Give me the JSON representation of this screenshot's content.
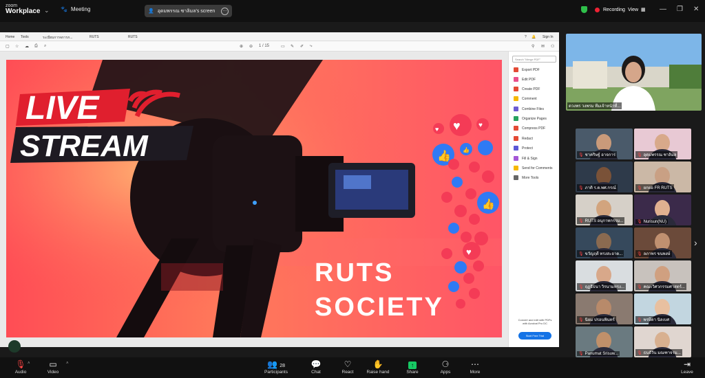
{
  "app": {
    "title_small": "zoom",
    "title": "Workplace"
  },
  "topbar": {
    "meeting_label": "Meeting",
    "share_label": "อุดมพรรณ ซาลิมล's screen",
    "recording_label": "Recording",
    "view_label": "View"
  },
  "acrobat": {
    "tabs": [
      "Home",
      "Tools",
      "ระเบียบการจการก...",
      "RUTS",
      "RUTS"
    ],
    "right_links": [
      "Sign In"
    ],
    "page_indicator": "1  /  15",
    "search_placeholder": "Search \"Merge PDF\"",
    "tools": [
      {
        "label": "Export PDF",
        "color": "#e34a35"
      },
      {
        "label": "Edit PDF",
        "color": "#e94f8b"
      },
      {
        "label": "Create PDF",
        "color": "#e34a35"
      },
      {
        "label": "Comment",
        "color": "#f5b800"
      },
      {
        "label": "Combine Files",
        "color": "#6b5bd2"
      },
      {
        "label": "Organize Pages",
        "color": "#27a25f"
      },
      {
        "label": "Compress PDF",
        "color": "#e34a35"
      },
      {
        "label": "Redact",
        "color": "#e34a35"
      },
      {
        "label": "Protect",
        "color": "#5b57d6"
      },
      {
        "label": "Fill & Sign",
        "color": "#a457d6"
      },
      {
        "label": "Send for Comments",
        "color": "#f5b800"
      },
      {
        "label": "More Tools",
        "color": "#666666"
      }
    ],
    "promo_text": "Convert and edit with PDFs with Acrobat Pro DC",
    "trial_label": "Start Free Trial"
  },
  "slide": {
    "live": "LIVE",
    "stream": "STREAM",
    "ruts": "RUTS",
    "society": "SOCIETY"
  },
  "speaker": {
    "name": "ดวงพร วงพรม ทีมเจ้าหน้าที่..."
  },
  "participants": [
    "ชาคริษฐ์ อาจการ",
    "อุดมพรรณ ซาลิมล",
    "ภาติ ร.ต.พศ.กรณ์",
    "ยกยอ FR RUTS",
    "RUTS อนุกาทกรรม...",
    "Nurisun(NU)",
    "ขวัญฤดี ทรงสะอาด...",
    "ลภาพร ขนพงษ์",
    "ฤฏธิธนา วิรนามหรง...",
    "คณะวิศวกรรมศาสตร์...",
    "นิยม ปรอนพินทร์",
    "พรษีดา นิลเบศ",
    "Panumat Srisuw...",
    "ธนธัวัน มณฑาจรม..."
  ],
  "bottombar": {
    "audio": "Audio",
    "video": "Video",
    "participants_count": "28",
    "participants": "Participants",
    "chat": "Chat",
    "react": "React",
    "raise_hand": "Raise hand",
    "share": "Share",
    "apps": "Apps",
    "more": "More",
    "leave": "Leave"
  },
  "colors": {
    "slide_bg": "#ff5a5a",
    "share_green": "#17c964",
    "acrobat_blue": "#1473e6"
  }
}
